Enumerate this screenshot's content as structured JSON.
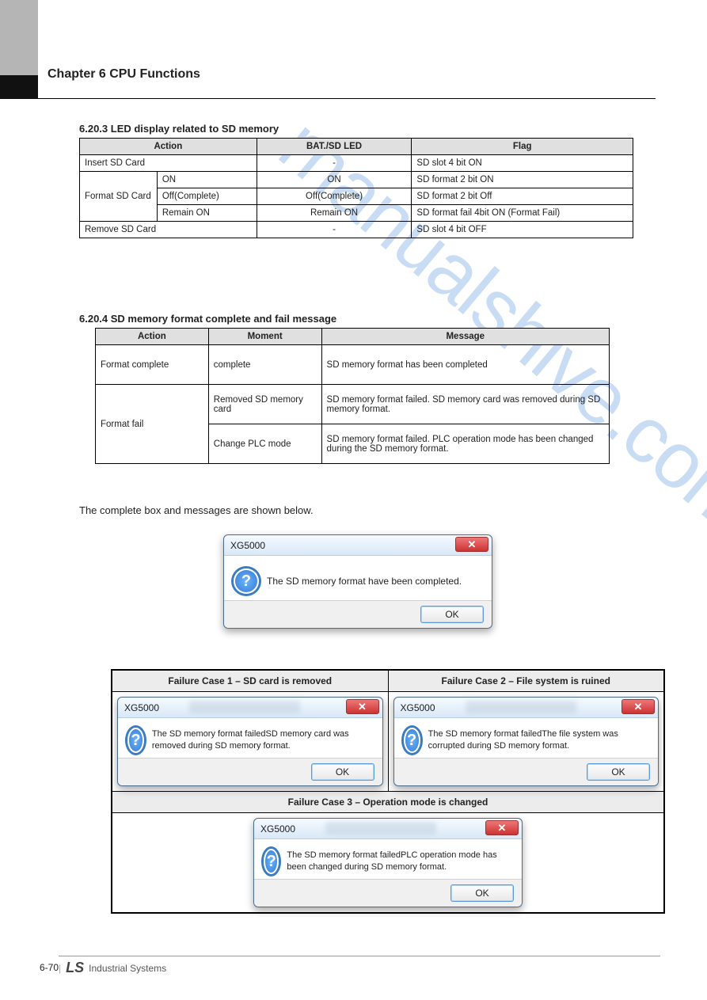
{
  "header": {
    "chapter": "Chapter 6 CPU Functions"
  },
  "section1": {
    "title": "6.20.3 LED display related to SD memory",
    "table": {
      "head": [
        "Action",
        "BAT./SD LED",
        "Flag"
      ],
      "rows": [
        [
          "Insert SD Card",
          "-",
          "SD slot 4 bit ON"
        ],
        [
          "Format SD Card",
          "ON",
          "SD format 2 bit ON"
        ],
        [
          "",
          "Off(Complete)",
          "SD format 2 bit Off"
        ],
        [
          "",
          "Remain ON",
          "SD format fail 4bit ON (Format Fail)"
        ],
        [
          "Remove SD Card",
          "-",
          "SD slot 4 bit OFF"
        ]
      ],
      "rowspan_label": "Format SD Card"
    }
  },
  "section2": {
    "title": "6.20.4 SD memory format complete and fail message",
    "table": {
      "head": [
        "Action",
        "Moment",
        "Message"
      ],
      "rows": [
        [
          "Format complete",
          "complete",
          "SD memory format has been completed"
        ],
        [
          "Format fail",
          "Removed SD memory card",
          "SD memory format failed. SD memory card was removed during SD memory format."
        ],
        [
          "",
          "Change PLC mode",
          "SD memory format failed. PLC operation mode has been changed during the SD memory format."
        ]
      ],
      "rowspan_label": "Format fail"
    }
  },
  "para": "The complete box and messages are shown below.",
  "dialogs": {
    "title": "XG5000",
    "ok": "OK",
    "complete": "The SD memory format have been completed.",
    "fail_headers": [
      "Failure Case 1 – SD card is removed",
      "Failure Case 2 – File system is ruined"
    ],
    "fail1": "The SD memory format failedSD memory card was removed during SD memory format.",
    "fail2": "The SD memory format failedThe file system was corrupted during SD memory format.",
    "fail3_header": "Failure Case 3 – Operation mode is changed",
    "fail3": "The SD memory format failedPLC operation mode has been changed during SD memory format."
  },
  "footer": {
    "logo": "LS",
    "sub": "Industrial Systems",
    "page": "6-70"
  },
  "watermark": "manualshive.com"
}
